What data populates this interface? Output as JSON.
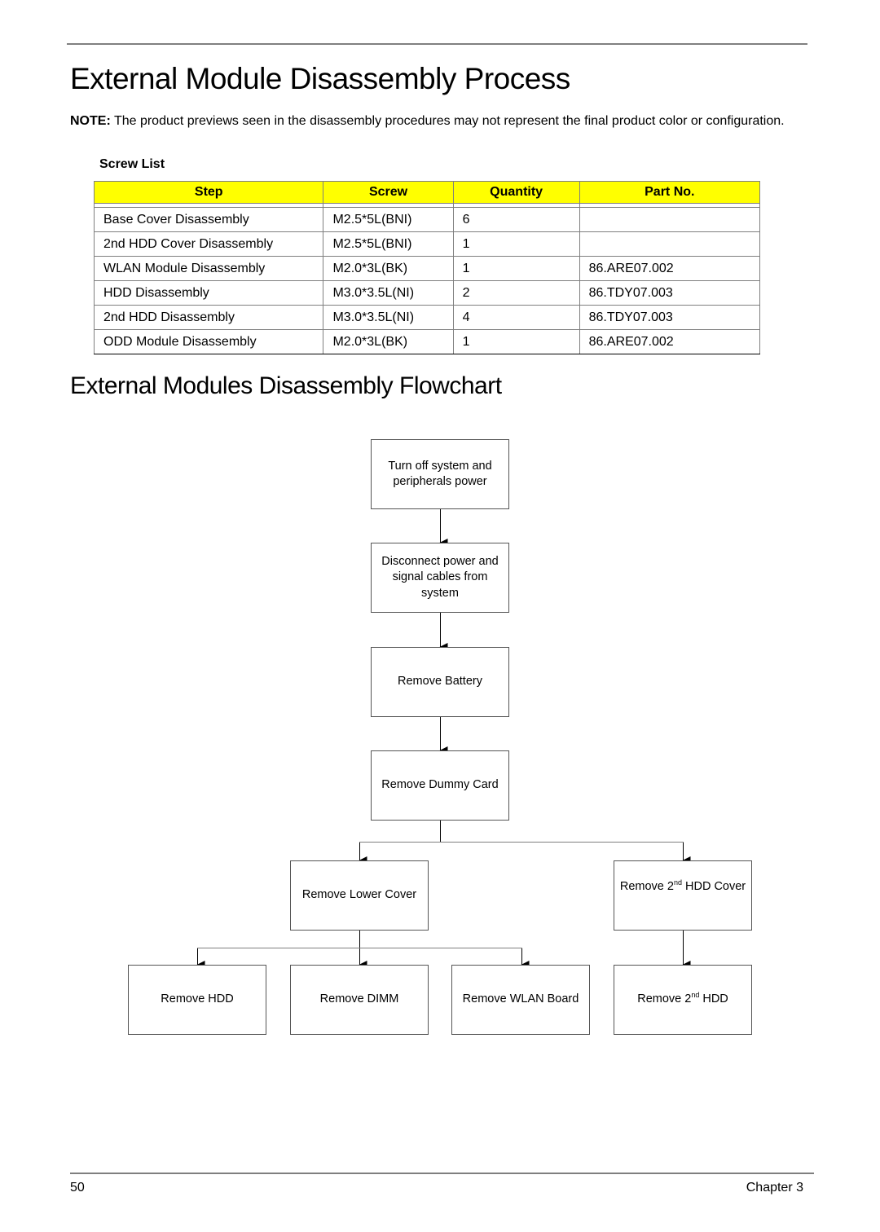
{
  "page": {
    "title": "External Module Disassembly Process",
    "note_label": "NOTE:",
    "note_text": " The product previews seen in the disassembly procedures may not represent the final product color or configuration.",
    "screw_list_label": "Screw List"
  },
  "table": {
    "headers": [
      "Step",
      "Screw",
      "Quantity",
      "Part No."
    ],
    "header_color": "#ffff00",
    "rows": [
      [
        "Base Cover Disassembly",
        "M2.5*5L(BNI)",
        "6",
        ""
      ],
      [
        "2nd HDD Cover Disassembly",
        "M2.5*5L(BNI)",
        "1",
        ""
      ],
      [
        "WLAN Module Disassembly",
        "M2.0*3L(BK)",
        "1",
        "86.ARE07.002"
      ],
      [
        "HDD Disassembly",
        "M3.0*3.5L(NI)",
        "2",
        "86.TDY07.003"
      ],
      [
        "2nd HDD Disassembly",
        "M3.0*3.5L(NI)",
        "4",
        "86.TDY07.003"
      ],
      [
        "ODD Module Disassembly",
        "M2.0*3L(BK)",
        "1",
        "86.ARE07.002"
      ]
    ]
  },
  "flowchart": {
    "title": "External Modules Disassembly Flowchart",
    "nodes": {
      "turn_off": "Turn off system and peripherals power",
      "disconnect": "Disconnect power and signal cables from system",
      "battery": "Remove Battery",
      "dummy_card": "Remove Dummy Card",
      "lower_cover": "Remove Lower Cover",
      "hdd2_cover": {
        "pre": "Remove 2",
        "sup": "nd",
        "post": " HDD Cover"
      },
      "hdd": "Remove HDD",
      "dimm": "Remove DIMM",
      "wlan": "Remove WLAN Board",
      "hdd2": {
        "pre": "Remove 2",
        "sup": "nd",
        "post": " HDD"
      }
    },
    "edges": [
      [
        "turn_off",
        "disconnect"
      ],
      [
        "disconnect",
        "battery"
      ],
      [
        "battery",
        "dummy_card"
      ],
      [
        "dummy_card",
        "lower_cover"
      ],
      [
        "dummy_card",
        "hdd2_cover"
      ],
      [
        "lower_cover",
        "hdd"
      ],
      [
        "lower_cover",
        "dimm"
      ],
      [
        "lower_cover",
        "wlan"
      ],
      [
        "hdd2_cover",
        "hdd2"
      ]
    ]
  },
  "footer": {
    "page_number": "50",
    "chapter": "Chapter 3"
  }
}
